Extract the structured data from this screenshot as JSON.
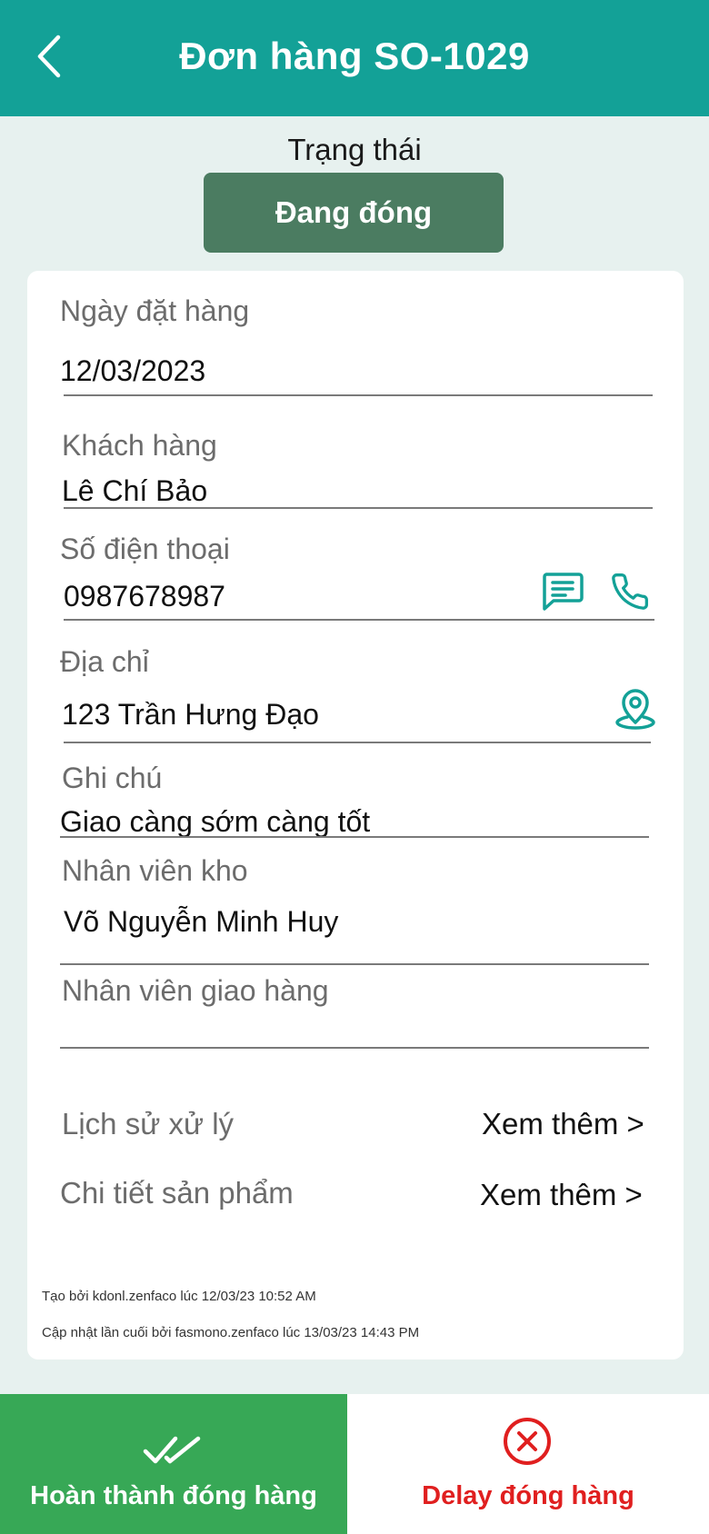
{
  "header": {
    "title": "Đơn hàng SO-1029",
    "back_icon": "chevron-left-icon"
  },
  "status": {
    "label": "Trạng thái",
    "value": "Đang đóng",
    "color": "#4b7c61"
  },
  "fields": {
    "order_date": {
      "label": "Ngày đặt hàng",
      "value": "12/03/2023"
    },
    "customer": {
      "label": "Khách hàng",
      "value": "Lê Chí Bảo"
    },
    "phone": {
      "label": "Số điện thoại",
      "value": "0987678987"
    },
    "address": {
      "label": "Địa chỉ",
      "value": "123 Trần Hưng Đạo"
    },
    "note": {
      "label": "Ghi chú",
      "value": "Giao càng sớm càng tốt"
    },
    "warehouse_staff": {
      "label": "Nhân viên kho",
      "value": "Võ Nguyễn Minh Huy"
    },
    "delivery_staff": {
      "label": "Nhân viên giao hàng",
      "value": ""
    }
  },
  "links": {
    "history": {
      "label": "Lịch sử xử lý",
      "action": "Xem thêm >"
    },
    "products": {
      "label": "Chi tiết sản phẩm",
      "action": "Xem thêm >"
    }
  },
  "meta": {
    "created": "Tạo bởi kdonl.zenfaco lúc 12/03/23 10:52 AM",
    "updated": "Cập nhật lần cuối bởi fasmono.zenfaco lúc 13/03/23 14:43 PM"
  },
  "actions": {
    "complete": {
      "label": "Hoàn thành đóng hàng",
      "icon": "double-check-icon",
      "color": "#37a856"
    },
    "delay": {
      "label": "Delay đóng hàng",
      "icon": "cancel-circle-icon",
      "color": "#e01f1f"
    }
  },
  "colors": {
    "primary": "#13a197",
    "background": "#e7f1ef"
  }
}
